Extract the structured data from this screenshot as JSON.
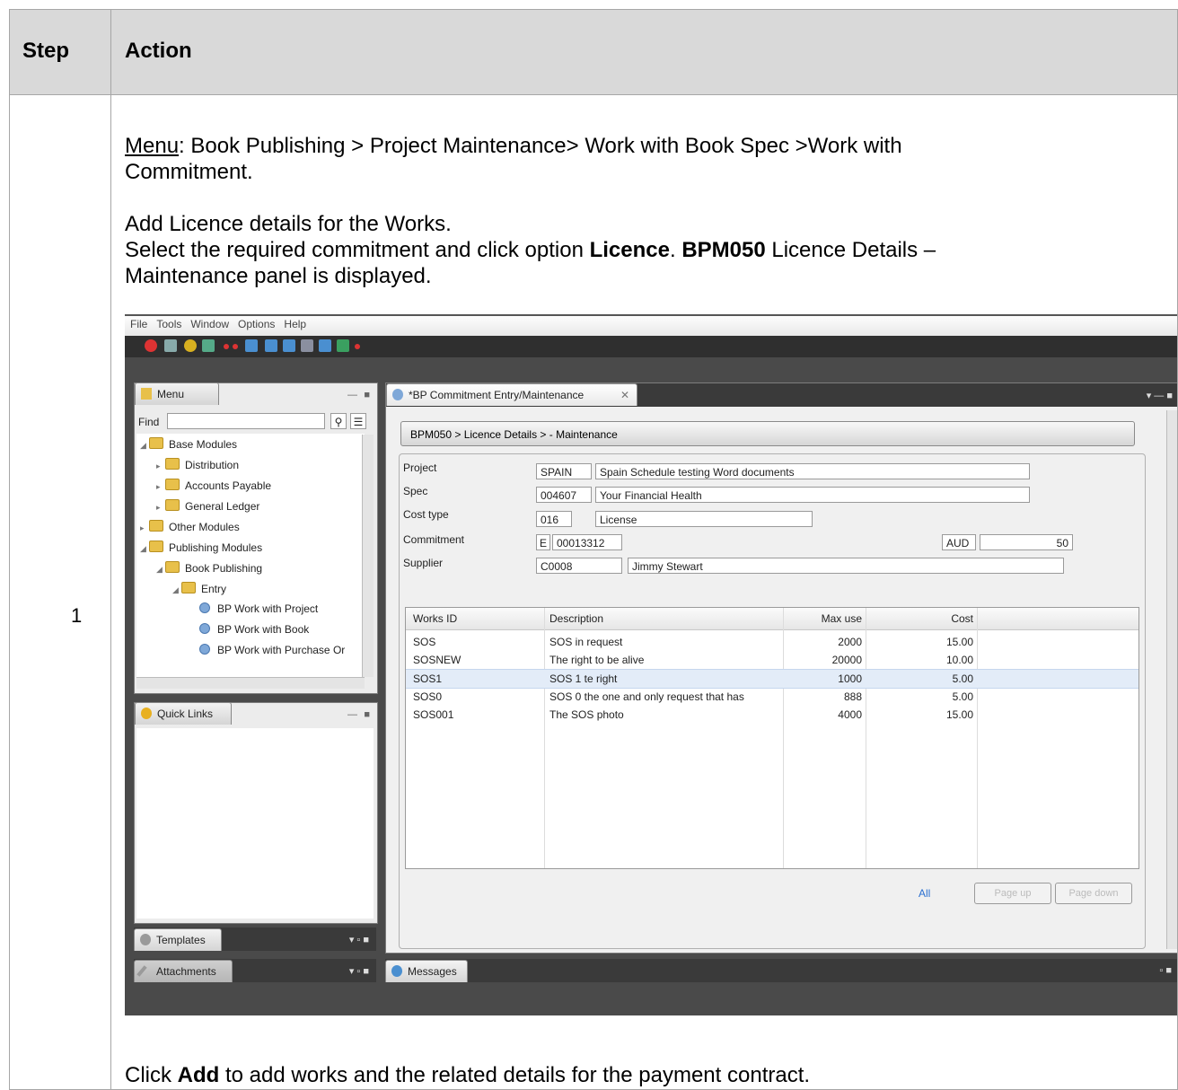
{
  "header": {
    "step": "Step",
    "action": "Action"
  },
  "row": {
    "step_number": "1",
    "menu_label": "Menu",
    "menu_path": ": Book Publishing > Project Maintenance> Work with Book Spec >Work with",
    "menu_path_cont": "Commitment.",
    "line_add": "Add Licence details for the Works.",
    "line_select_1": "Select the required commitment and click option ",
    "line_select_bold_1": "Licence",
    "line_select_2": ". ",
    "line_select_bold_2": "BPM050",
    "line_select_3": " Licence Details –",
    "line_select_cont": "Maintenance panel is displayed.",
    "footer_1": "Click ",
    "footer_bold": "Add",
    "footer_2": " to add works and the related details for the payment contract."
  },
  "screenshot": {
    "menubar": [
      "File",
      "Tools",
      "Window",
      "Options",
      "Help"
    ],
    "menu_panel": {
      "tab": "Menu",
      "find_label": "Find",
      "tree": [
        {
          "label": "Base Modules",
          "level": 0,
          "type": "folder"
        },
        {
          "label": "Distribution",
          "level": 1,
          "type": "folder"
        },
        {
          "label": "Accounts Payable",
          "level": 1,
          "type": "folder"
        },
        {
          "label": "General Ledger",
          "level": 1,
          "type": "folder"
        },
        {
          "label": "Other Modules",
          "level": 0,
          "type": "folder"
        },
        {
          "label": "Publishing Modules",
          "level": 0,
          "type": "folder"
        },
        {
          "label": "Book Publishing",
          "level": 1,
          "type": "folder"
        },
        {
          "label": "Entry",
          "level": 2,
          "type": "folder"
        },
        {
          "label": "BP Work with Project",
          "level": 3,
          "type": "item"
        },
        {
          "label": "BP Work with Book",
          "level": 3,
          "type": "item"
        },
        {
          "label": "BP Work with Purchase Or",
          "level": 3,
          "type": "item"
        }
      ]
    },
    "quick_links_tab": "Quick Links",
    "templates_tab": "Templates",
    "attachments_tab": "Attachments",
    "messages_tab": "Messages",
    "editor_tab": "*BP Commitment Entry/Maintenance",
    "breadcrumb": "BPM050 > Licence Details > - Maintenance",
    "form": {
      "project_label": "Project",
      "project_code": "SPAIN",
      "project_desc": "Spain Schedule testing Word documents",
      "spec_label": "Spec",
      "spec_code": "004607",
      "spec_desc": "Your Financial Health",
      "cost_type_label": "Cost type",
      "cost_type_code": "016",
      "cost_type_desc": "License",
      "commitment_label": "Commitment",
      "commitment_type": "E",
      "commitment_no": "00013312",
      "currency": "AUD",
      "amount": "50",
      "supplier_label": "Supplier",
      "supplier_code": "C0008",
      "supplier_name": "Jimmy Stewart"
    },
    "grid": {
      "headers": [
        "Works ID",
        "Description",
        "Max use",
        "Cost"
      ],
      "rows": [
        [
          "SOS",
          "SOS in request",
          "2000",
          "15.00"
        ],
        [
          "SOSNEW",
          "The right to be alive",
          "20000",
          "10.00"
        ],
        [
          "SOS1",
          "SOS 1 te right",
          "1000",
          "5.00"
        ],
        [
          "SOS0",
          "SOS 0 the one and only request that has",
          "888",
          "5.00"
        ],
        [
          "SOS001",
          "The SOS photo",
          "4000",
          "15.00"
        ]
      ],
      "selected_row": 2
    },
    "pager": {
      "all": "All",
      "page_up": "Page up",
      "page_down": "Page down"
    }
  }
}
